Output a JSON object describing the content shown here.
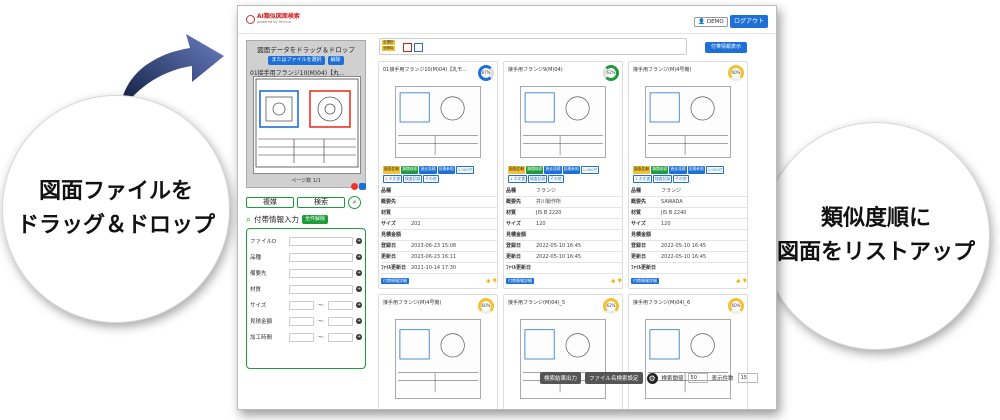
{
  "callouts": {
    "left_line1": "図面ファイルを",
    "left_line2": "ドラッグ＆ドロップ",
    "right_line1": "類似度順に",
    "right_line2": "図面をリストアップ"
  },
  "app": {
    "logo_title": "AI類似図面検索",
    "logo_sub": "powered by Techno",
    "demo_label": "DEMO",
    "logout_label": "ログアウト"
  },
  "left": {
    "drop_title": "図面データをドラッグ＆ドロップ",
    "select_file_label": "またはファイルを選択",
    "clear_label": "解除",
    "file_name": "01接手用フランジ10(M)04)【丸...",
    "page_count": "ページ数 1/1",
    "btn_duplicate": "複媒",
    "btn_search": "検索",
    "attr_title": "付帯情報入力",
    "clear_all": "全件解除",
    "fields": [
      {
        "label": "ファイルD"
      },
      {
        "label": "品種"
      },
      {
        "label": "備要先"
      },
      {
        "label": "材質"
      },
      {
        "label": "サイズ",
        "range": true
      },
      {
        "label": "見積金額",
        "range": true
      },
      {
        "label": "加工時間",
        "range": true
      }
    ]
  },
  "filter": {
    "tag1": "全選択",
    "tag2": "全解除",
    "attr_display": "付帯情報表示"
  },
  "cards": [
    {
      "title": "01接手用フランジ10(M)04)【丸モ...",
      "score": "87%",
      "ring": "blue",
      "info": [
        [
          "品種",
          ""
        ],
        [
          "概要先",
          ""
        ],
        [
          "材質",
          ""
        ],
        [
          "サイズ",
          "202"
        ],
        [
          "見積金額",
          ""
        ],
        [
          "登録日",
          "2023-06-23 15:08"
        ],
        [
          "更新日",
          "2023-06-23 16:11"
        ],
        [
          "ﾌｧｲﾙ更新日",
          "2021-10-14 17:30"
        ]
      ]
    },
    {
      "title": "接手用フランジ9(M)04)",
      "score": "62%",
      "ring": "green",
      "info": [
        [
          "品種",
          "フランジ"
        ],
        [
          "概要先",
          "井川製作所"
        ],
        [
          "材質",
          "JIS B 2220"
        ],
        [
          "サイズ",
          "120"
        ],
        [
          "見積金額",
          ""
        ],
        [
          "登録日",
          "2022-05-10 16:45"
        ],
        [
          "更新日",
          "2022-05-10 16:45"
        ],
        [
          "ﾌｧｲﾙ更新日",
          ""
        ]
      ]
    },
    {
      "title": "接手用フランジ(M)4号機)",
      "score": "60%",
      "ring": "yellow",
      "info": [
        [
          "品種",
          "フランジ"
        ],
        [
          "概要先",
          "SAWADA"
        ],
        [
          "材質",
          "JIS B 2240"
        ],
        [
          "サイズ",
          "120"
        ],
        [
          "見積金額",
          ""
        ],
        [
          "登録日",
          "2022-05-10 16:45"
        ],
        [
          "更新日",
          "2022-05-10 16:45"
        ],
        [
          "ﾌｧｲﾙ更新日",
          ""
        ]
      ]
    },
    {
      "title": "接手用フランジ(M)4号機)",
      "score": "60%",
      "ring": "yellow"
    },
    {
      "title": "接手用フランジ(M)04)_5",
      "score": "62%",
      "ring": "yellow"
    },
    {
      "title": "接手用フランジ(M)04)_6",
      "score": "60%",
      "ring": "yellow"
    }
  ],
  "badges": [
    "図面比較",
    "類題検索",
    "過去見積",
    "見積参照",
    "1,000セ",
    "1.ネ文書",
    "検査記録",
    "その他"
  ],
  "card_foot": {
    "link": "付帯情報詳細",
    "like": "👍 👎"
  },
  "bottom": {
    "export_label": "検索結果出力",
    "filename_label": "ファイル名検索設定",
    "threshold_label": "検索閾値",
    "threshold_value": "50",
    "display_label": "表示件数",
    "display_value": "15"
  }
}
